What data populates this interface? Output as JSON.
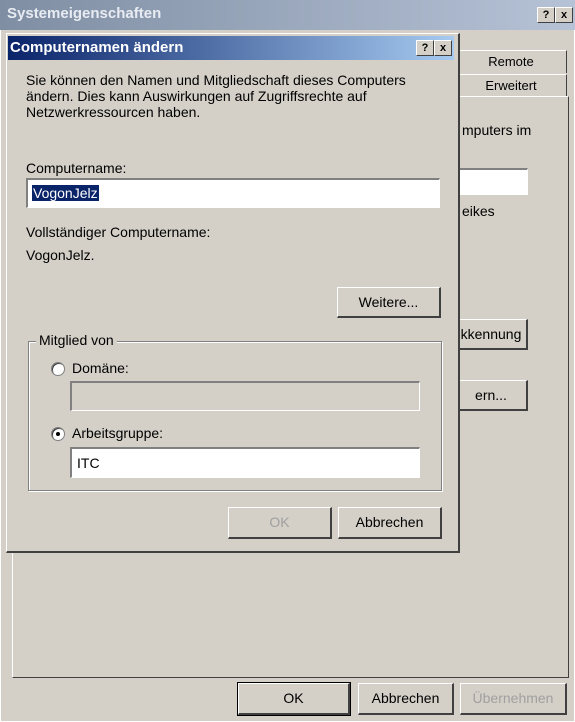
{
  "back_window": {
    "title": "Systemeigenschaften",
    "help_btn": "?",
    "close_btn": "x",
    "tabs": [
      "Remote",
      "Erweitert"
    ],
    "partial_texts": [
      "mputers im",
      "eikes"
    ],
    "partial_buttons": [
      "kkennung",
      "ern..."
    ],
    "buttons": {
      "ok": "OK",
      "cancel": "Abbrechen",
      "apply": "Übernehmen"
    }
  },
  "dialog": {
    "title": "Computernamen ändern",
    "help_btn": "?",
    "close_btn": "x",
    "description": "Sie können den Namen und Mitgliedschaft dieses Computers ändern. Dies kann Auswirkungen auf Zugriffsrechte auf Netzwerkressourcen haben.",
    "computer_name_label": "Computername:",
    "computer_name_value": "VogonJelz",
    "full_name_label": "Vollständiger Computername:",
    "full_name_value": "VogonJelz.",
    "more_button": "Weitere...",
    "member_of": {
      "label": "Mitglied von",
      "domain_label": "Domäne:",
      "domain_value": "",
      "workgroup_label": "Arbeitsgruppe:",
      "workgroup_value": "ITC",
      "selected": "workgroup"
    },
    "ok_button": "OK",
    "cancel_button": "Abbrechen"
  }
}
